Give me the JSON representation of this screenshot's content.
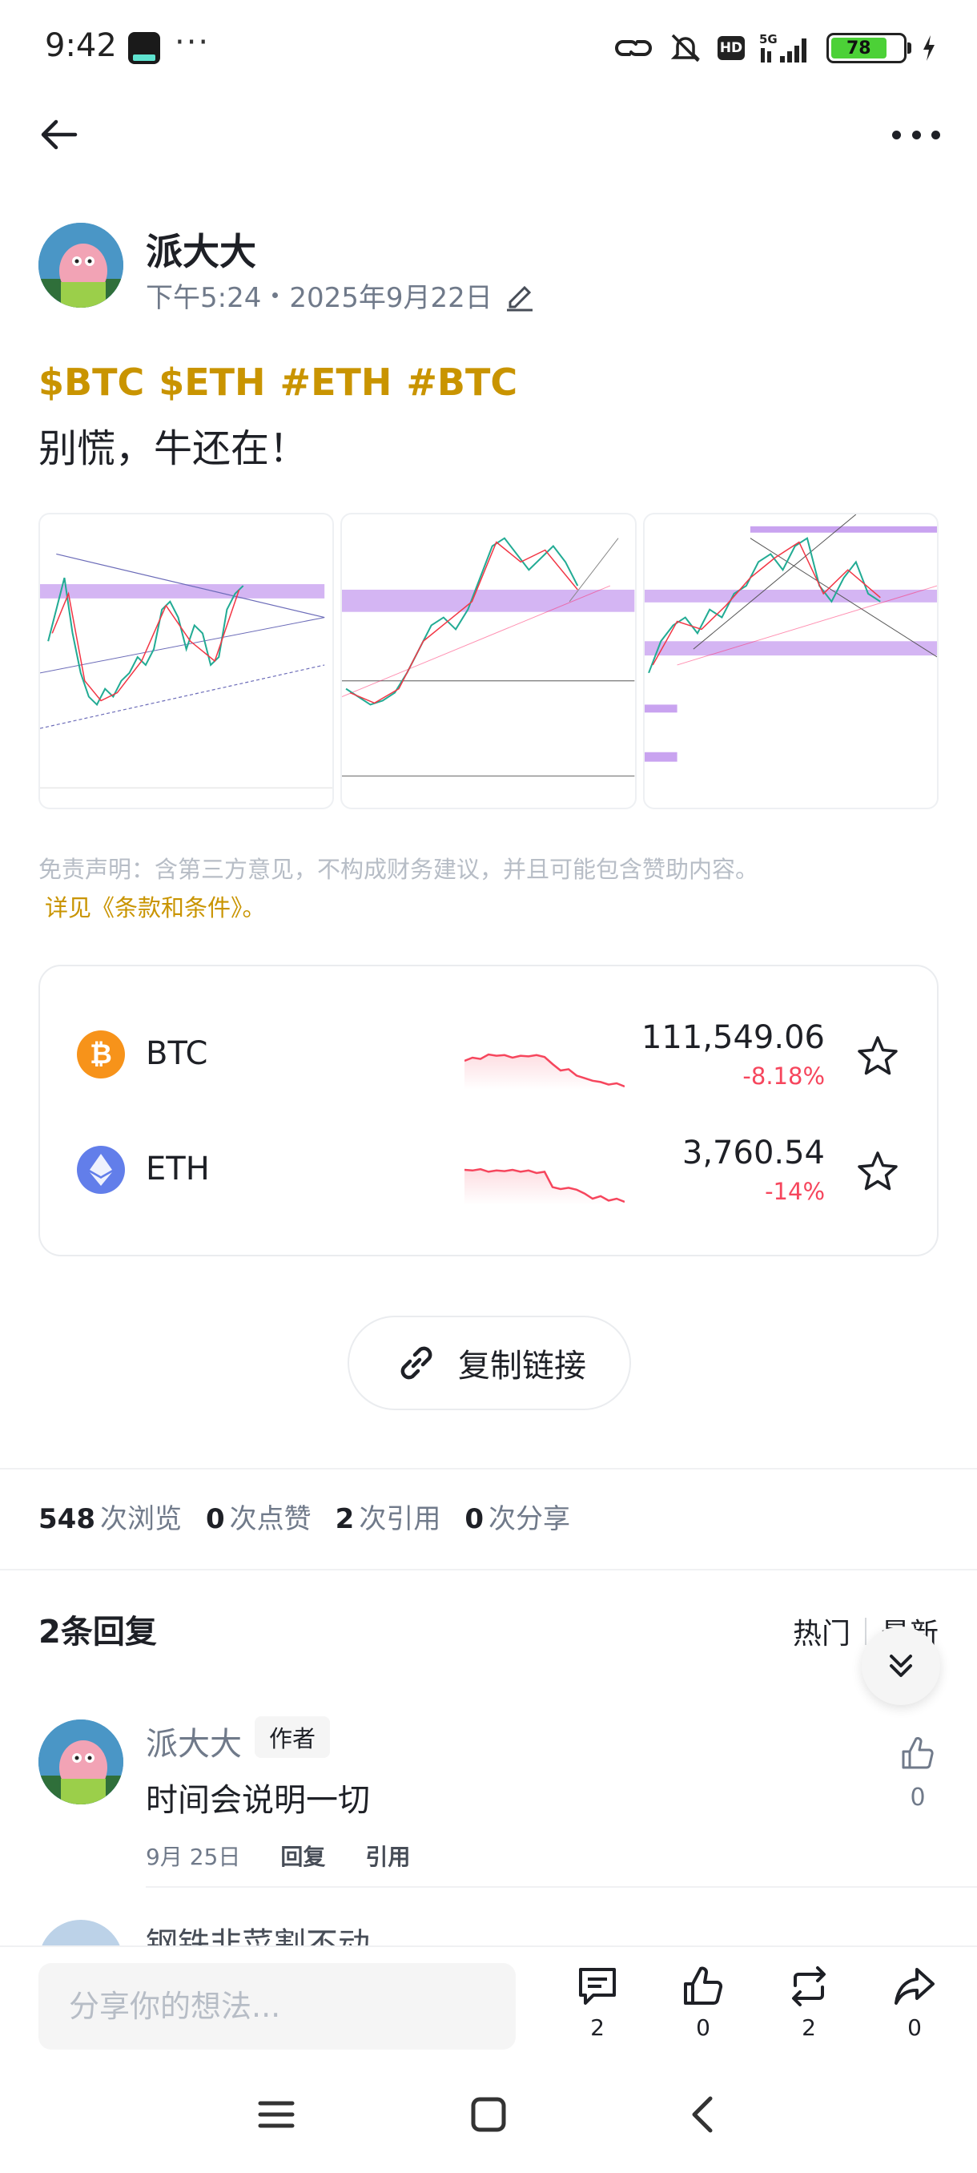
{
  "status_bar": {
    "time": "9:42",
    "dots": "···",
    "hd": "HD",
    "network": "5G",
    "battery": "78"
  },
  "post": {
    "author": "派大大",
    "time": "下午5:24",
    "date": "2025年9月22日",
    "tags": [
      "$BTC",
      "$ETH",
      "#ETH",
      "#BTC"
    ],
    "text": "别慌，牛还在！",
    "disclaimer": "免责声明：含第三方意见，不构成财务建议，并且可能包含赞助内容。",
    "terms_link": "详见《条款和条件》。"
  },
  "coins": [
    {
      "symbol": "BTC",
      "price": "111,549.06",
      "change": "-8.18%",
      "icon": "bitcoin-icon",
      "color": "#f7931a",
      "spark": [
        0.55,
        0.5,
        0.52,
        0.45,
        0.47,
        0.46,
        0.5,
        0.47,
        0.48,
        0.46,
        0.49,
        0.6,
        0.7,
        0.68,
        0.78,
        0.82,
        0.86,
        0.88,
        0.92,
        0.9,
        0.95
      ]
    },
    {
      "symbol": "ETH",
      "price": "3,760.54",
      "change": "-14%",
      "icon": "ethereum-icon",
      "color": "#627eea",
      "spark": [
        0.45,
        0.46,
        0.44,
        0.48,
        0.46,
        0.47,
        0.45,
        0.48,
        0.46,
        0.5,
        0.48,
        0.72,
        0.75,
        0.73,
        0.76,
        0.82,
        0.9,
        0.86,
        0.93,
        0.9,
        0.95
      ]
    }
  ],
  "copy_link": "复制链接",
  "stats": [
    {
      "num": "548",
      "label": "次浏览"
    },
    {
      "num": "0",
      "label": "次点赞"
    },
    {
      "num": "2",
      "label": "次引用"
    },
    {
      "num": "0",
      "label": "次分享"
    }
  ],
  "replies": {
    "title": "2条回复",
    "sort_hot": "热门",
    "sort_new": "最新",
    "items": [
      {
        "name": "派大大",
        "badge": "作者",
        "text": "时间会说明一切",
        "date": "9月 25日",
        "reply": "回复",
        "quote": "引用",
        "likes": "0"
      },
      {
        "name": "钢铁非菜割不动"
      }
    ]
  },
  "bottom_bar": {
    "placeholder": "分享你的想法...",
    "comments": "2",
    "likes": "0",
    "reposts": "2",
    "shares": "0"
  },
  "colors": {
    "accent": "#c99400",
    "down": "#f6465d",
    "text": "#1e2026",
    "muted": "#707a8a"
  }
}
